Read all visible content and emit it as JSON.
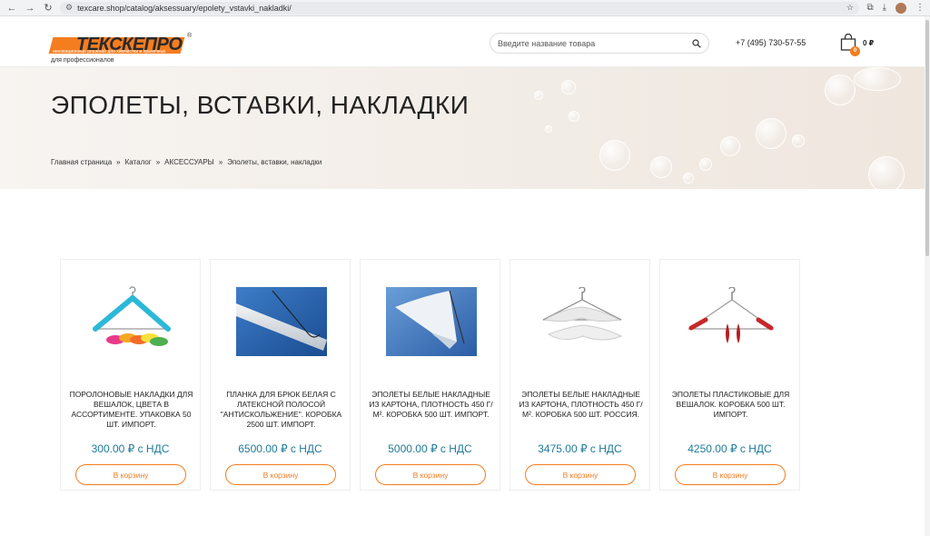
{
  "browser": {
    "url": "texcare.shop/catalog/aksessuary/epolety_vstavki_nakladki/"
  },
  "header": {
    "logo_text": "ТЕКСКЕПРО",
    "logo_reg": "®",
    "logo_tagline": "инновационные решений для химчистки и прачечных",
    "logo_subtitle": "для профессионалов",
    "search_placeholder": "Введите название товара",
    "phone": "+7 (495) 730-57-55",
    "cart_count": "0",
    "cart_total": "0 ₽"
  },
  "hero": {
    "title": "ЭПОЛЕТЫ, ВСТАВКИ, НАКЛАДКИ",
    "breadcrumbs": [
      "Главная страница",
      "»",
      "Каталог",
      "»",
      "АКСЕССУАРЫ",
      "»",
      "Эполеты, вставки, накладки"
    ]
  },
  "products": [
    {
      "title": "ПОРОЛОНОВЫЕ НАКЛАДКИ ДЛЯ ВЕШАЛОК, ЦВЕТА В АССОРТИМЕНТЕ. УПАКОВКА 50 ШТ. ИМПОРТ.",
      "price": "300.00 ₽ с НДС",
      "button": "В корзину"
    },
    {
      "title": "ПЛАНКА ДЛЯ БРЮК БЕЛАЯ С ЛАТЕКСНОЙ ПОЛОСОЙ \"АНТИСКОЛЬЖЕНИЕ\". КОРОБКА 2500 ШТ. ИМПОРТ.",
      "price": "6500.00 ₽ с НДС",
      "button": "В корзину"
    },
    {
      "title": "ЭПОЛЕТЫ БЕЛЫЕ НАКЛАДНЫЕ ИЗ КАРТОНА, ПЛОТНОСТЬ 450 Г/М². КОРОБКА 500 ШТ. ИМПОРТ.",
      "price": "5000.00 ₽ с НДС",
      "button": "В корзину"
    },
    {
      "title": "ЭПОЛЕТЫ БЕЛЫЕ НАКЛАДНЫЕ ИЗ КАРТОНА, ПЛОТНОСТЬ 450 Г/М². КОРОБКА 500 ШТ. РОССИЯ.",
      "price": "3475.00 ₽ с НДС",
      "button": "В корзину"
    },
    {
      "title": "ЭПОЛЕТЫ ПЛАСТИКОВЫЕ ДЛЯ ВЕШАЛОК. КОРОБКА 500 ШТ. ИМПОРТ.",
      "price": "4250.00 ₽ с НДС",
      "button": "В корзину"
    }
  ],
  "colors": {
    "accent": "#f47d20",
    "price": "#1e7b99"
  }
}
